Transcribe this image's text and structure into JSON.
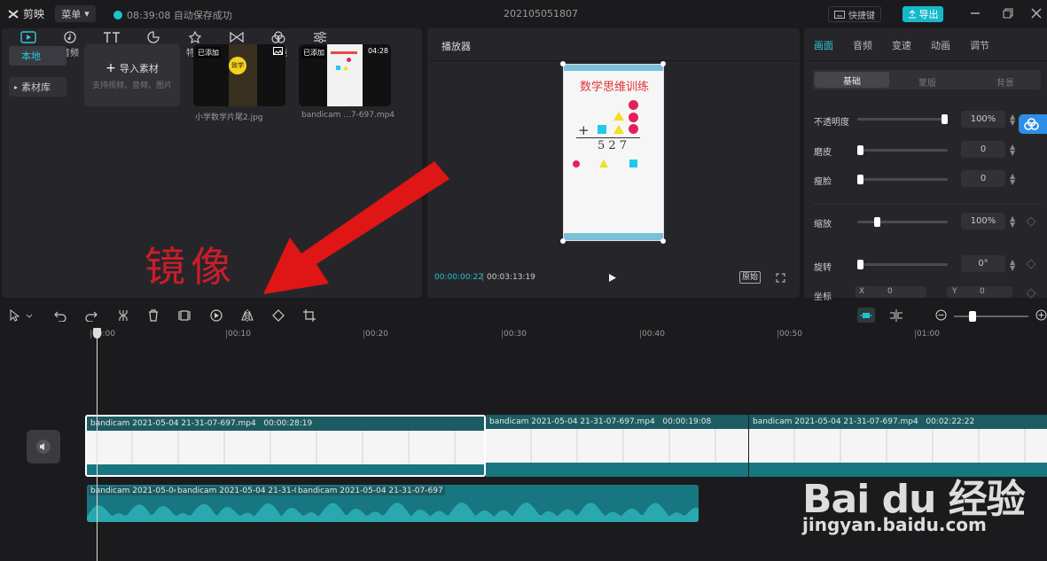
{
  "app": {
    "logo_text": "剪映",
    "menu_label": "菜单",
    "autosave_text": "08:39:08 自动保存成功",
    "project_name": "202105051807",
    "shortcut_label": "快捷键",
    "export_label": "导出"
  },
  "media_tabs": [
    {
      "label": "媒体",
      "icon": "media-icon",
      "active": true
    },
    {
      "label": "音频",
      "icon": "audio-icon"
    },
    {
      "label": "文本",
      "icon": "text-icon"
    },
    {
      "label": "贴纸",
      "icon": "sticker-icon"
    },
    {
      "label": "特效",
      "icon": "effects-icon"
    },
    {
      "label": "转场",
      "icon": "transition-icon"
    },
    {
      "label": "滤镜",
      "icon": "filter-icon"
    },
    {
      "label": "调节",
      "icon": "adjust-icon"
    }
  ],
  "media_side": {
    "local": "本地",
    "library": "素材库"
  },
  "import_box": {
    "title": "导入素材",
    "subtitle": "支持视频、音频、图片"
  },
  "media_items": [
    {
      "badge": "已添加",
      "thumb_text": "致学",
      "filename": "小学数学片尾2.jpg"
    },
    {
      "badge": "已添加",
      "duration": "04:28",
      "filename": "bandicam ...7-697.mp4"
    }
  ],
  "player": {
    "title": "播放器",
    "video_title": "数学思维训练",
    "video_number": "5 2 7",
    "current_time": "00:00:00:22",
    "separator": "|",
    "total_time": "00:03:13:19",
    "original_label": "原始"
  },
  "props_tabs": [
    "画面",
    "音频",
    "变速",
    "动画",
    "调节"
  ],
  "props_segments": [
    "基础",
    "蒙版",
    "背景"
  ],
  "props_rows": [
    {
      "label": "不透明度",
      "value": "100%",
      "level": 1.0
    },
    {
      "label": "磨皮",
      "value": "0",
      "level": 0.0
    },
    {
      "label": "瘦脸",
      "value": "0",
      "level": 0.0
    },
    {
      "label": "缩放",
      "value": "100%",
      "level": 0.2
    },
    {
      "label": "旋转",
      "value": "0°",
      "level": 0.0
    }
  ],
  "coords": {
    "label": "坐标",
    "x_label": "X",
    "x_value": "0",
    "y_label": "Y",
    "y_value": "0"
  },
  "ruler_ticks": [
    "00:00",
    "00:10",
    "00:20",
    "00:30",
    "00:40",
    "00:50",
    "01:00"
  ],
  "video_clips": [
    {
      "name": "bandicam 2021-05-04 21-31-07-697.mp4",
      "duration": "00:00:28:19",
      "selected": true
    },
    {
      "name": "bandicam 2021-05-04 21-31-07-697.mp4",
      "duration": "00:00:19:08"
    },
    {
      "name": "bandicam 2021-05-04 21-31-07-697.mp4",
      "duration": "00:02:22:22"
    }
  ],
  "audio_clips": [
    "bandicam 2021-05-04",
    "bandicam 2021-05-04 21-31-0",
    "bandicam 2021-05-04 21-31-07-697"
  ],
  "annotation": {
    "text": "镜像",
    "color": "#c81e2a"
  },
  "watermark": {
    "brand": "Bai du 经验",
    "site": "jingyan.baidu.com"
  },
  "colors": {
    "accent": "#1fc2d0",
    "clip": "#177680",
    "export": "#17b9c9"
  }
}
